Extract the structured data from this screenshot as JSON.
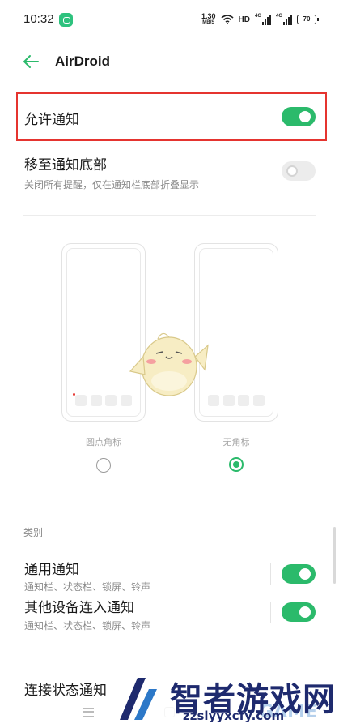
{
  "status_bar": {
    "time": "10:32",
    "net_speed_value": "1.30",
    "net_speed_unit": "MB/S",
    "hd_label": "HD",
    "sim1_tag": "4G",
    "sim2_tag": "4G",
    "battery": "70"
  },
  "header": {
    "title": "AirDroid"
  },
  "settings": {
    "allow_notifications": {
      "label": "允许通知",
      "enabled": true
    },
    "move_to_bottom": {
      "label": "移至通知底部",
      "description": "关闭所有提醒，仅在通知栏底部折叠显示",
      "enabled": false
    }
  },
  "preview": {
    "options": [
      {
        "caption": "圆点角标",
        "selected": false
      },
      {
        "caption": "无角标",
        "selected": true
      }
    ]
  },
  "categories": {
    "section_label": "类别",
    "items": [
      {
        "label": "通用通知",
        "description": "通知栏、状态栏、锁屏、铃声",
        "enabled": true
      },
      {
        "label": "其他设备连入通知",
        "description": "通知栏、状态栏、锁屏、铃声",
        "enabled": true
      },
      {
        "label": "连接状态通知"
      }
    ]
  },
  "watermark": {
    "name": "智者游戏网",
    "url": "zzslyyxcfy.com",
    "overlay": "GAME"
  },
  "colors": {
    "accent": "#2bba6b",
    "highlight": "#e5342f"
  },
  "icons": {
    "back": "arrow-left-icon",
    "notification_app": "chat-bubble-icon"
  }
}
